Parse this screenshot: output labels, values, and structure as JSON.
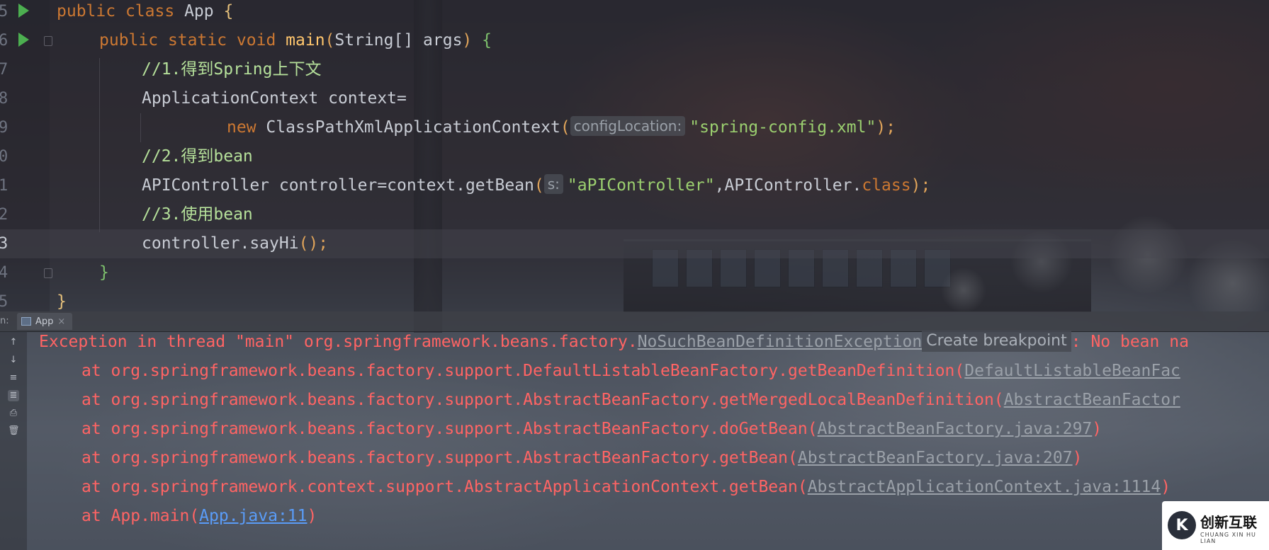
{
  "editor": {
    "lines": [
      {
        "num": "5",
        "parts": [
          "public",
          "class",
          "App",
          "{"
        ]
      },
      {
        "num": "6",
        "parts": [
          "public",
          "static",
          "void",
          "main",
          "(",
          "String[] args",
          ")",
          "{"
        ]
      },
      {
        "num": "7",
        "comment": "//1.得到Spring上下文"
      },
      {
        "num": "8",
        "code": "ApplicationContext context="
      },
      {
        "num": "9",
        "new_kw": "new",
        "class_name": "ClassPathXmlApplicationContext",
        "open": "(",
        "hint": "configLocation:",
        "arg": "\"spring-config.xml\"",
        "close": ")",
        "semi": ";"
      },
      {
        "num": "0",
        "comment": "//2.得到bean"
      },
      {
        "num": "1",
        "code_pre": "APIController controller=context.getBean",
        "open": "(",
        "hint": "s:",
        "arg": "\"aPIController\"",
        "mid": ",APIController.",
        "class_kw": "class",
        "close": ")",
        "semi": ";"
      },
      {
        "num": "2",
        "comment": "//3.使用bean"
      },
      {
        "num": "3",
        "code_pre": "controller.sayHi",
        "parens": "()",
        "semi": ";"
      },
      {
        "num": "4",
        "close_brace": "}"
      },
      {
        "num": "5",
        "close_brace": "}"
      }
    ]
  },
  "run_panel": {
    "label": "n:",
    "tab_label": "App",
    "tab_close": "×",
    "tools": [
      "↑",
      "↓",
      "≡",
      "≣",
      "⎙",
      "🗑"
    ]
  },
  "console": {
    "exception_prefix": "Exception in thread \"main\" org.springframework.beans.factory.",
    "exception_link": "NoSuchBeanDefinitionException",
    "breakpoint_hint": "Create breakpoint",
    "exception_suffix": ": No bean na",
    "stack": [
      {
        "text": "at org.springframework.beans.factory.support.DefaultListableBeanFactory.getBeanDefinition(",
        "link": "DefaultListableBeanFac",
        "tail": ""
      },
      {
        "text": "at org.springframework.beans.factory.support.AbstractBeanFactory.getMergedLocalBeanDefinition(",
        "link": "AbstractBeanFactor",
        "tail": ""
      },
      {
        "text": "at org.springframework.beans.factory.support.AbstractBeanFactory.doGetBean(",
        "link": "AbstractBeanFactory.java:297",
        "tail": ")"
      },
      {
        "text": "at org.springframework.beans.factory.support.AbstractBeanFactory.getBean(",
        "link": "AbstractBeanFactory.java:207",
        "tail": ")"
      },
      {
        "text": "at org.springframework.context.support.AbstractApplicationContext.getBean(",
        "link": "AbstractApplicationContext.java:1114",
        "tail": ")"
      },
      {
        "text": "at App.main(",
        "link": "App.java:11",
        "tail": ")"
      }
    ]
  },
  "watermark": {
    "logo": "K",
    "text": "创新互联",
    "sub": "CHUANG XIN HU LIAN"
  }
}
